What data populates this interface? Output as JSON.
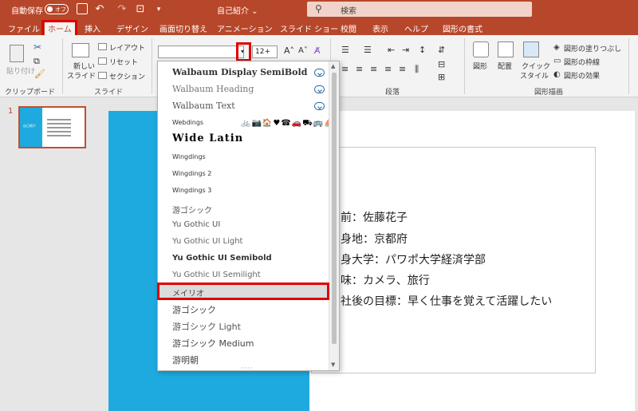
{
  "titlebar": {
    "autosave_label": "自動保存",
    "autosave_state": "オフ",
    "doc_title": "自己紹介 ⌄",
    "search_placeholder": "検索"
  },
  "tabs": [
    "ファイル",
    "ホーム",
    "挿入",
    "デザイン",
    "画面切り替え",
    "アニメーション",
    "スライド ショー",
    "校閲",
    "表示",
    "ヘルプ",
    "図形の書式"
  ],
  "active_tab": "ホーム",
  "ribbon": {
    "paste_label": "貼り付け",
    "clipboard_group": "クリップボード",
    "new_slide_label1": "新しい",
    "new_slide_label2": "スライド",
    "layout_label": "レイアウト",
    "reset_label": "リセット",
    "section_label": "セクション",
    "slides_group": "スライド",
    "font_size": "12+",
    "paragraph_group": "段落",
    "shape_label": "図形",
    "arrange_label": "配置",
    "quick_style_label1": "クイック",
    "quick_style_label2": "スタイル",
    "shape_fill": "図形の塗りつぶし",
    "shape_outline": "図形の枠線",
    "shape_effect": "図形の効果",
    "drawing_group": "図形描画"
  },
  "thumbnail": {
    "number": "1",
    "caption": "自己紹介"
  },
  "font_list": [
    "Walbaum Display SemiBold",
    "Walbaum Heading",
    "Walbaum Text",
    "Webdings",
    "Wide Latin",
    "Wingdings",
    "Wingdings 2",
    "Wingdings 3",
    "游ゴシック",
    "Yu Gothic UI",
    "Yu Gothic UI Light",
    "Yu Gothic UI Semibold",
    "Yu Gothic UI Semilight",
    "メイリオ",
    "游ゴシック",
    "游ゴシック Light",
    "游ゴシック Medium",
    "游明朝"
  ],
  "webdings_sample": "🚲📷🏠♥☎🚗⛟🚌⛵",
  "slide_lines": [
    "前：佐藤花子",
    "身地：京都府",
    "身大学：パワポ大学経済学部",
    "味：カメラ、旅行",
    "社後の目標：早く仕事を覚えて活躍したい"
  ],
  "colors": {
    "accent": "#b7472a",
    "slide_blue": "#1eaadf",
    "highlight": "#e00000"
  }
}
